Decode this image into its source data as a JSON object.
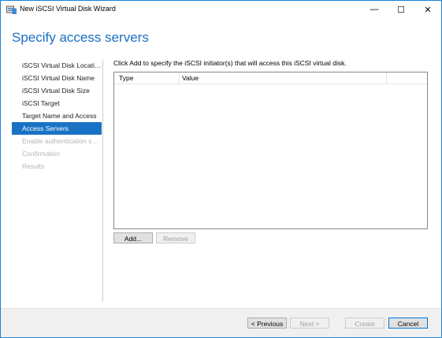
{
  "window": {
    "title": "New iSCSI Virtual Disk Wizard",
    "controls": {
      "minimize": "—",
      "maximize": "☐",
      "close": "✕"
    },
    "border_color": "#1883d7"
  },
  "page": {
    "title": "Specify access servers",
    "title_color": "#1a6fc2",
    "instruction": "Click Add to specify the iSCSI initiator(s) that will access this iSCSI virtual disk."
  },
  "nav": {
    "active_color": "#1a72c4",
    "items": [
      {
        "label": "iSCSI Virtual Disk Location",
        "state": "normal"
      },
      {
        "label": "iSCSI Virtual Disk Name",
        "state": "normal"
      },
      {
        "label": "iSCSI Virtual Disk Size",
        "state": "normal"
      },
      {
        "label": "iSCSI Target",
        "state": "normal"
      },
      {
        "label": "Target Name and Access",
        "state": "normal"
      },
      {
        "label": "Access Servers",
        "state": "active"
      },
      {
        "label": "Enable authentication ser...",
        "state": "disabled"
      },
      {
        "label": "Confirmation",
        "state": "disabled"
      },
      {
        "label": "Results",
        "state": "disabled"
      }
    ]
  },
  "grid": {
    "columns": [
      "Type",
      "Value"
    ],
    "rows": []
  },
  "actions": {
    "add": "Add...",
    "remove": "Remove"
  },
  "footer": {
    "previous": "< Previous",
    "next": "Next >",
    "create": "Create",
    "cancel": "Cancel"
  }
}
